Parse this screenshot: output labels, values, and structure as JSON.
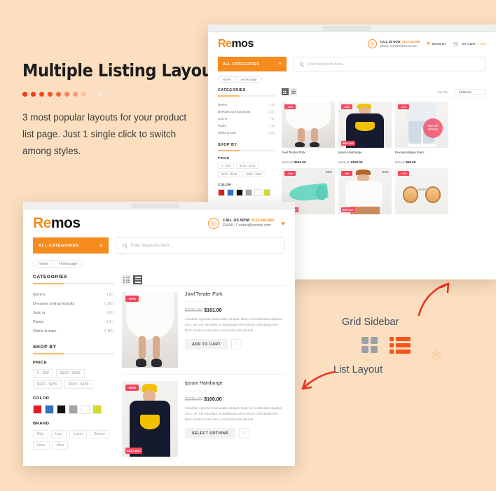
{
  "promo": {
    "title": "Multiple Listing Layouts",
    "body": "3 most popular layouts for your product list page. Just 1 single click to switch among styles.",
    "dot_colors": [
      "#f4391a",
      "#f4391a",
      "#f5441f",
      "#f5542b",
      "#f6663b",
      "#f8835c",
      "#fa9e7f",
      "#fcbda8",
      "#fdded3",
      "#fde8dd"
    ]
  },
  "brand": {
    "name_accent": "Re",
    "name_rest": "mos"
  },
  "header": {
    "call_label": "CALL US NOW:",
    "call_number": "0123-444-666",
    "email_label": "EMAIL:",
    "email_value": "Contact@remos.com",
    "wishlist": "WISHLIST",
    "cart": "MY CART",
    "cart_count": "0 item",
    "all_categories": "ALL CATEGORIES",
    "search_placeholder": "Enter keywords here..",
    "breadcrumbs": [
      "Home",
      "Home page"
    ]
  },
  "sidebar": {
    "categories_title": "CATEGORIES",
    "categories": [
      {
        "label": "Denim",
        "count": "( 6 )"
      },
      {
        "label": "Dresses and jumpsuits",
        "count": "( 10 )"
      },
      {
        "label": "Just in",
        "count": "( 8 )"
      },
      {
        "label": "Pants",
        "count": "( 6 )"
      },
      {
        "label": "Shirts & tops",
        "count": "( 10 )"
      }
    ],
    "shop_by_title": "SHOP BY",
    "price_title": "PRICE",
    "price_ranges": [
      "0 - $99",
      "$100 - $199",
      "$200 - $299",
      "$300 - $399"
    ],
    "color_title": "COLOR",
    "colors": [
      "#e02020",
      "#2f72c4",
      "#111111",
      "#a6a6a6",
      "#ffffff",
      "#d7db2a"
    ],
    "brand_title": "BRAND",
    "brands": [
      "Dior",
      "Lion",
      "Lucci",
      "Cherry",
      "Lime",
      "Nice"
    ]
  },
  "toolbar": {
    "sort_label": "Sort by:",
    "sort_value": "Featured",
    "view_grid": "grid-view-icon",
    "view_list": "list-view-icon"
  },
  "list_window": {
    "products": [
      {
        "name": "Jowl Tender Pork",
        "old_price": "$200.00",
        "price": "$161.00",
        "sale_badge": "-20%",
        "desc": "Curabitur egestas malesuada volutpat. Nunc vel vestibulum dapibus nunc nec est imperdiet, a malesuada sem rutrum. Sed aliquet leo. Nunc ornare metus urna, eu luctus velit placerat.",
        "cta": "ADD TO CART",
        "best_badge": ""
      },
      {
        "name": "Ipsum Hamburge",
        "old_price": "$239.00",
        "price": "$100.00",
        "sale_badge": "-58%",
        "desc": "Curabitur egestas malesuada volutpat. Nunc vel vestibulum dapibus nunc nec est imperdiet, a malesuada sem rutrum. Sed aliquet leo. Nunc ornare metus urna, eu luctus velit placerat.",
        "cta": "SELECT OPTIONS",
        "best_badge": "BEST-BUY"
      }
    ]
  },
  "grid_window": {
    "row1": [
      {
        "name": "Jowl Tender Pork",
        "old_price": "$200.00",
        "price": "$161.00",
        "sale_badge": "-20%",
        "flag": "",
        "best_badge": "",
        "stock_badge": ""
      },
      {
        "name": "Ipsum Hamburge",
        "old_price": "$239.00",
        "price": "$100.00",
        "sale_badge": "-58%",
        "flag": "",
        "best_badge": "BEST-BUY",
        "stock_badge": ""
      },
      {
        "name": "Dexcep Magna Exerc",
        "old_price": "$75.00",
        "price": "$65.00",
        "sale_badge": "-11%",
        "flag": "",
        "best_badge": "",
        "stock_badge": "OUT OF STOCK"
      }
    ],
    "row2": [
      {
        "name": "",
        "old_price": "",
        "price": "",
        "sale_badge": "-13%",
        "flag": "NEW",
        "best_badge": "BEST-BUY",
        "stock_badge": ""
      },
      {
        "name": "",
        "old_price": "",
        "price": "",
        "sale_badge": "-5%",
        "flag": "NEW",
        "best_badge": "BEST-BUY",
        "stock_badge": ""
      },
      {
        "name": "",
        "old_price": "",
        "price": "",
        "sale_badge": "-17%",
        "flag": "",
        "best_badge": "",
        "stock_badge": ""
      }
    ]
  },
  "annotations": {
    "grid_sidebar": "Grid Sidebar",
    "list_layout": "List Layout"
  },
  "stars": "☆☆☆☆☆"
}
